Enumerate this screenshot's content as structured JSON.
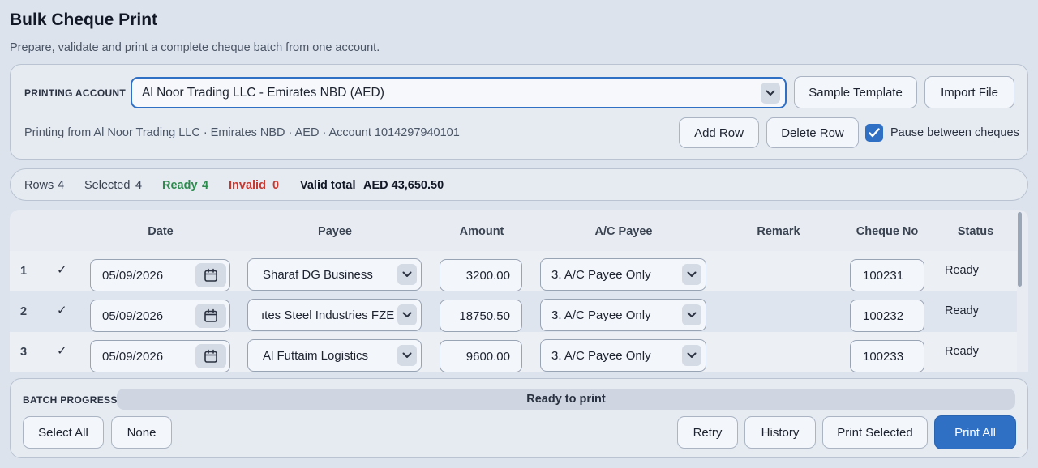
{
  "header": {
    "title": "Bulk Cheque Print",
    "subtitle": "Prepare, validate and print a complete cheque batch from one account."
  },
  "account_panel": {
    "label": "PRINTING ACCOUNT",
    "selected_account": "Al Noor Trading LLC - Emirates NBD (AED)",
    "info": "Printing from Al Noor Trading LLC · Emirates NBD · AED · Account 1014297940101",
    "sample_template_label": "Sample Template",
    "import_file_label": "Import File",
    "add_row_label": "Add Row",
    "delete_row_label": "Delete Row",
    "pause_label": "Pause between cheques",
    "pause_checked": true
  },
  "summary": {
    "rows_label": "Rows",
    "rows_value": "4",
    "selected_label": "Selected",
    "selected_value": "4",
    "ready_label": "Ready",
    "ready_value": "4",
    "invalid_label": "Invalid",
    "invalid_value": "0",
    "total_label": "Valid total",
    "total_value": "AED 43,650.50",
    "colors": {
      "ready": "#2e8b4e",
      "invalid": "#c8382f"
    }
  },
  "table": {
    "columns": [
      "Date",
      "Payee",
      "Amount",
      "A/C Payee",
      "Remark",
      "Cheque No",
      "Status"
    ],
    "rows": [
      {
        "num": "1",
        "checked": "✓",
        "date": "05/09/2026",
        "payee": "Sharaf DG Business",
        "amount": "3200.00",
        "acp": "3.  A/C Payee Only",
        "remark": "",
        "cheque_no": "100231",
        "status": "Ready"
      },
      {
        "num": "2",
        "checked": "✓",
        "date": "05/09/2026",
        "payee": "ıtes Steel Industries FZE",
        "amount": "18750.50",
        "acp": "3.  A/C Payee Only",
        "remark": "",
        "cheque_no": "100232",
        "status": "Ready"
      },
      {
        "num": "3",
        "checked": "✓",
        "date": "05/09/2026",
        "payee": "Al Futtaim Logistics",
        "amount": "9600.00",
        "acp": "3.  A/C Payee Only",
        "remark": "",
        "cheque_no": "100233",
        "status": "Ready"
      }
    ]
  },
  "progress": {
    "label": "BATCH PROGRESS",
    "status_text": "Ready to print",
    "select_all_label": "Select All",
    "none_label": "None",
    "retry_label": "Retry",
    "history_label": "History",
    "print_selected_label": "Print Selected",
    "print_all_label": "Print All"
  },
  "icons": [
    "chevron-down-icon",
    "calendar-icon",
    "check-icon"
  ],
  "accent_color": "#2f6fc4"
}
